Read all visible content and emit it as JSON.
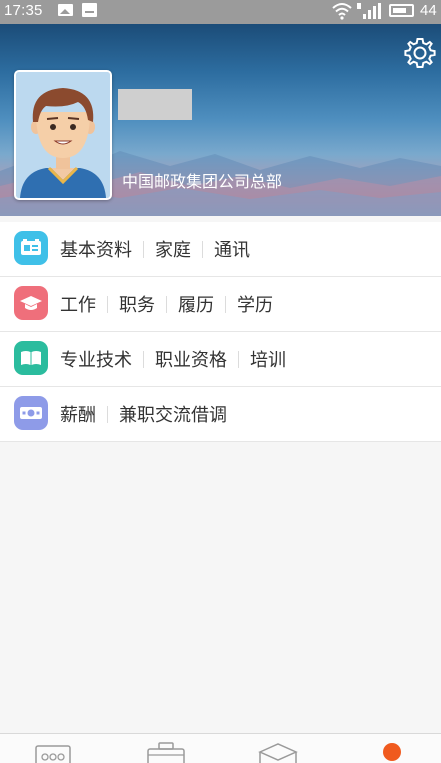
{
  "status_bar": {
    "time": "17:35",
    "battery_text": "44",
    "icons": [
      "image-icon",
      "message-icon",
      "wifi-icon",
      "signal-icon",
      "battery-icon"
    ]
  },
  "profile": {
    "organization": "中国邮政集团公司总部",
    "settings_icon": "gear-icon",
    "avatar_icon": "avatar-icon"
  },
  "menu": {
    "rows": [
      {
        "icon": "id-card-icon",
        "color": "#3fc0e8",
        "links": [
          "基本资料",
          "家庭",
          "通讯"
        ]
      },
      {
        "icon": "graduation-cap-icon",
        "color": "#ef6f7b",
        "links": [
          "工作",
          "职务",
          "履历",
          "学历"
        ]
      },
      {
        "icon": "book-icon",
        "color": "#2bbc9e",
        "links": [
          "专业技术",
          "职业资格",
          "培训"
        ]
      },
      {
        "icon": "money-icon",
        "color": "#8e9be8",
        "links": [
          "薪酬",
          "兼职交流借调"
        ]
      }
    ]
  },
  "bottom_nav": {
    "items": [
      "chat-icon",
      "briefcase-icon",
      "box-icon",
      "profile-dot-icon"
    ],
    "accent": "#f05a1e"
  }
}
